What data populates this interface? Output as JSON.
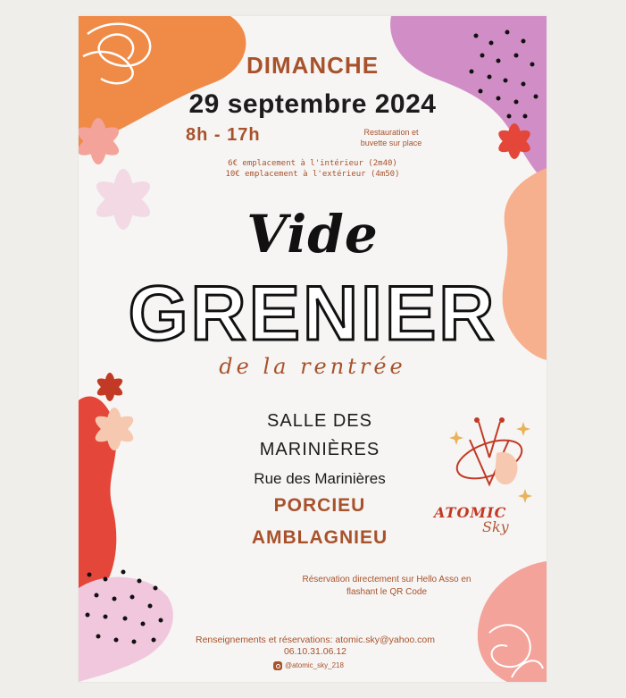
{
  "event": {
    "day": "DIMANCHE",
    "date": "29 septembre 2024",
    "hours": "8h - 17h",
    "catering_line1": "Restauration et",
    "catering_line2": "buvette sur place",
    "price_inside": "6€ emplacement à l'intérieur (2m40)",
    "price_outside": "10€ emplacement à l'extérieur (4m50)"
  },
  "title": {
    "vide": "Vide",
    "grenier": "GRENIER",
    "subtitle": "de la rentrée"
  },
  "venue": {
    "hall_line1": "SALLE DES",
    "hall_line2": "MARINIÈRES",
    "street": "Rue des Marinières",
    "town_line1": "PORCIEU",
    "town_line2": "AMBLAGNIEU"
  },
  "booking": {
    "line1": "Réservation directement sur Hello Asso en",
    "line2": "flashant le QR Code"
  },
  "contact": {
    "line1": "Renseignements et réservations: atomic.sky@yahoo.com",
    "phone": "06.10.31.06.12",
    "instagram": "@atomic_sky_218"
  },
  "logo": {
    "word1": "ATOMIC",
    "word2": "Sky"
  },
  "colors": {
    "accent": "#a8522c",
    "orange": "#f08a47",
    "pink": "#f3a39a",
    "lilac": "#d18ec6",
    "peach": "#f6b08e",
    "red": "#e4463a"
  }
}
